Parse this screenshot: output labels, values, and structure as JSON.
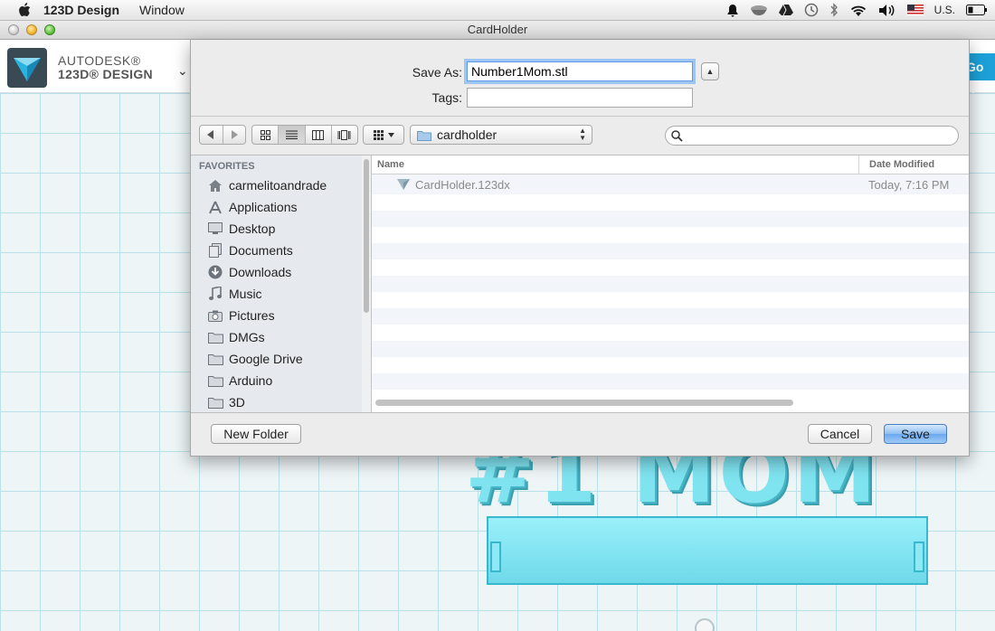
{
  "menubar": {
    "app_name": "123D Design",
    "menus": [
      "Window"
    ],
    "input_language": "U.S."
  },
  "window": {
    "title": "CardHolder"
  },
  "app_toolbar": {
    "brand_line1": "AUTODESK®",
    "brand_line2": "123D® DESIGN",
    "menu_chevron": "⌄",
    "go_pro_label": "Go P"
  },
  "viewport": {
    "model_text": "#1 MOM"
  },
  "save_dialog": {
    "save_as_label": "Save As:",
    "save_as_value": "Number1Mom.stl",
    "tags_label": "Tags:",
    "tags_value": "",
    "location": "cardholder",
    "search_value": "",
    "favorites_header": "FAVORITES",
    "favorites": [
      {
        "label": "carmelitoandrade",
        "icon": "home-icon"
      },
      {
        "label": "Applications",
        "icon": "applications-icon"
      },
      {
        "label": "Desktop",
        "icon": "desktop-icon"
      },
      {
        "label": "Documents",
        "icon": "documents-icon"
      },
      {
        "label": "Downloads",
        "icon": "downloads-icon"
      },
      {
        "label": "Music",
        "icon": "music-icon"
      },
      {
        "label": "Pictures",
        "icon": "camera-icon"
      },
      {
        "label": "DMGs",
        "icon": "folder-icon"
      },
      {
        "label": "Google Drive",
        "icon": "folder-icon"
      },
      {
        "label": "Arduino",
        "icon": "folder-icon"
      },
      {
        "label": "3D",
        "icon": "folder-icon"
      }
    ],
    "columns": {
      "name": "Name",
      "date_modified": "Date Modified"
    },
    "files": [
      {
        "name": "CardHolder.123dx",
        "date_modified": "Today, 7:16 PM",
        "icon": "123d-file-icon"
      }
    ],
    "buttons": {
      "new_folder": "New Folder",
      "cancel": "Cancel",
      "save": "Save"
    }
  },
  "colors": {
    "accent_blue": "#1da1d8",
    "model_cyan": "#7fe3f0",
    "grid_line": "#b9e1ea",
    "default_button": "#6aa8ee"
  }
}
